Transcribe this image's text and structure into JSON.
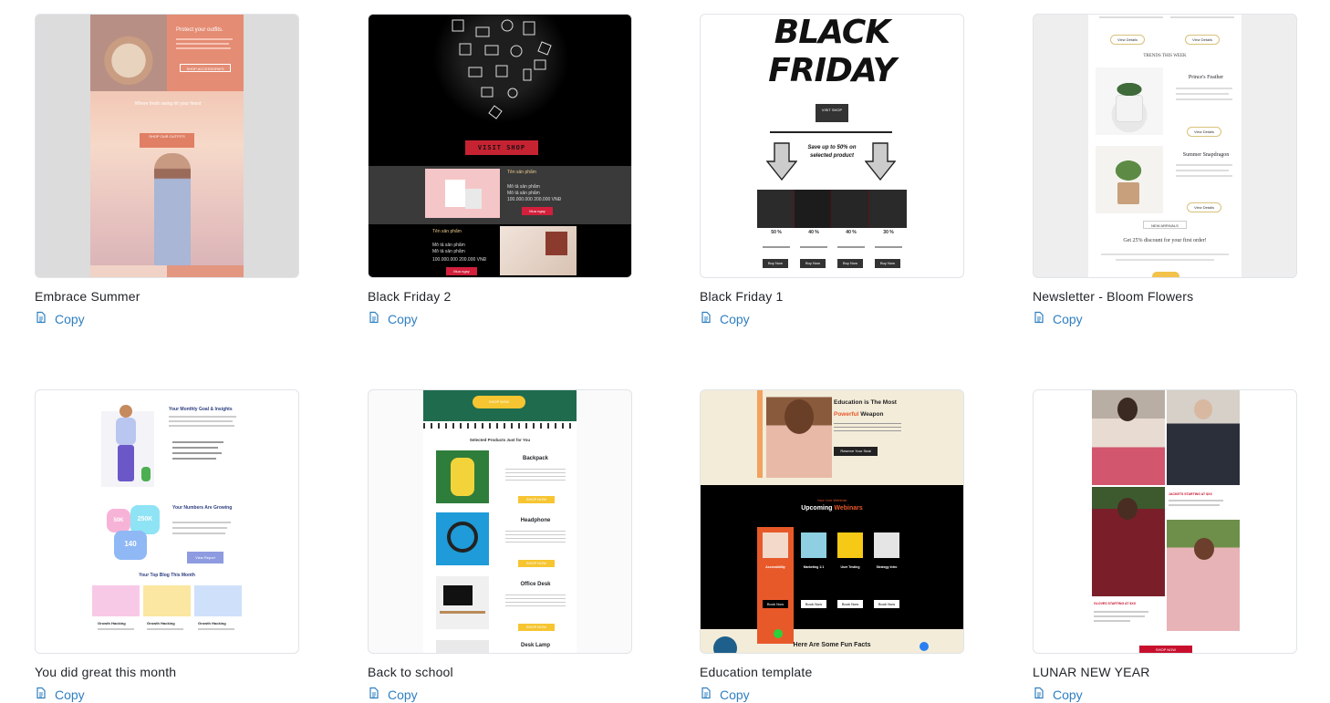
{
  "copy_label": "Copy",
  "templates": [
    {
      "title": "Embrace Summer",
      "thumb": {
        "heading": "Protect your outfits.",
        "button": "SHOP ACCESSORIES",
        "subheading": "Where fresh swing hit your finest",
        "cta": "SHOP OUR OUTFITS"
      }
    },
    {
      "title": "Black Friday 2",
      "thumb": {
        "shop_button": "VISIT SHOP",
        "product_name": "Tên sản phẩm",
        "product_line1": "Mô tả sản phẩm",
        "product_line2": "Mô tả sản phẩm",
        "price": "100.000.000 200.000 VNĐ",
        "buy_button": "Mua ngay"
      }
    },
    {
      "title": "Black Friday 1",
      "thumb": {
        "headline_top": "BLACK",
        "headline_bottom": "FRIDAY",
        "shop_button": "VISIT SHOP",
        "promo": "Save up to 50% on selected product",
        "discounts": [
          "50 %",
          "40 %",
          "40 %",
          "30 %"
        ],
        "buy_button": "Buy Now"
      }
    },
    {
      "title": "Newsletter - Bloom Flowers",
      "thumb": {
        "view_details": "View Details",
        "section_title": "TRENDS THIS WEEK",
        "product1": "Prince's Feather",
        "product2": "Summer Snapdragon",
        "new_arrivals": "NEW ARRIVALS",
        "discount": "Get 25% discount for your first order!"
      }
    },
    {
      "title": "You did great this month",
      "thumb": {
        "heading": "Your Monthly Goal & Insights",
        "numbers_heading": "Your Numbers Are Growing",
        "stat1": "50K",
        "stat2": "250K",
        "stat3": "140",
        "view_report": "View Report",
        "blog_heading": "Your Top Blog This Month",
        "blog_item": "Growth Hacking"
      }
    },
    {
      "title": "Back to school",
      "thumb": {
        "shop_button": "SHOP NOW",
        "section_title": "Selected Products Just for You",
        "items": [
          "Backpack",
          "Headphone",
          "Office Desk",
          "Desk Lamp"
        ],
        "item_button": "SHOP NOW"
      }
    },
    {
      "title": "Education template",
      "thumb": {
        "heading_line1": "Education is The Most",
        "heading_accent": "Powerful",
        "heading_rest": "Weapon",
        "reserve_button": "Reserve Your Seat",
        "webinars_kicker": "Your Live Webinar",
        "webinars_title": "Upcoming",
        "webinars_accent": "Webinars",
        "webinar_topics": [
          "Accessibility",
          "Marketing 1:1",
          "User Testing",
          "Strategy Intro"
        ],
        "book_button": "Book Now",
        "facts_heading": "Here Are Some Fun Facts"
      }
    },
    {
      "title": "LUNAR NEW YEAR",
      "thumb": {
        "jackets": "JACKETS STARTING AT $XX",
        "gloves": "GLOVES STARTING AT $XX",
        "shop_button": "SHOP NOW"
      }
    }
  ]
}
